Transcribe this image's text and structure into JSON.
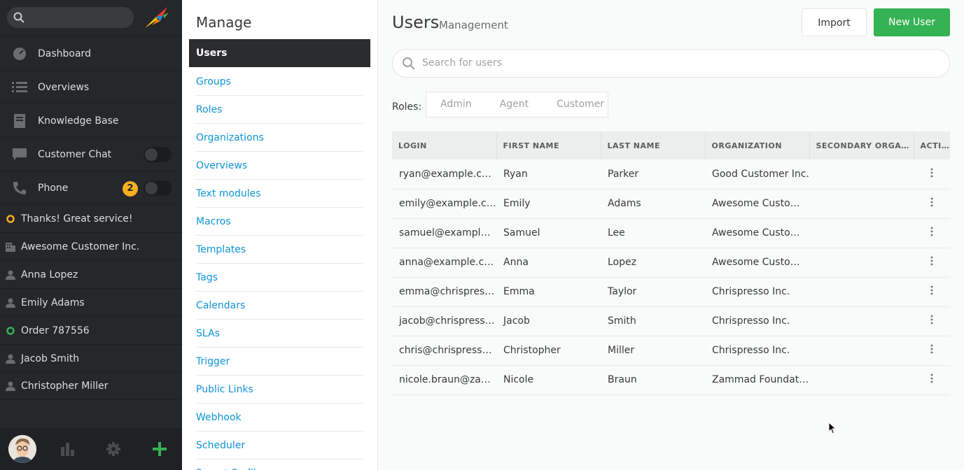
{
  "nav": {
    "search_placeholder": "",
    "items": [
      {
        "label": "Dashboard",
        "icon": "dashboard-icon"
      },
      {
        "label": "Overviews",
        "icon": "list-icon"
      },
      {
        "label": "Knowledge Base",
        "icon": "book-icon"
      },
      {
        "label": "Customer Chat",
        "icon": "chat-icon"
      },
      {
        "label": "Phone",
        "icon": "phone-icon",
        "badge": "2"
      }
    ],
    "tasks": [
      {
        "label": "Thanks! Great service!",
        "icon": "ticket-open-icon"
      },
      {
        "label": "Awesome Customer Inc.",
        "icon": "organization-icon"
      },
      {
        "label": "Anna Lopez",
        "icon": "user-icon"
      },
      {
        "label": "Emily Adams",
        "icon": "user-icon"
      },
      {
        "label": "Order 787556",
        "icon": "ticket-new-icon"
      },
      {
        "label": "Jacob Smith",
        "icon": "user-icon"
      },
      {
        "label": "Christopher Miller",
        "icon": "user-icon"
      }
    ]
  },
  "menu": {
    "title": "Manage",
    "items": [
      "Users",
      "Groups",
      "Roles",
      "Organizations",
      "Overviews",
      "Text modules",
      "Macros",
      "Templates",
      "Tags",
      "Calendars",
      "SLAs",
      "Trigger",
      "Public Links",
      "Webhook",
      "Scheduler",
      "Report Profiles"
    ]
  },
  "main": {
    "title": "Users",
    "subtitle": "Management",
    "import_label": "Import",
    "new_label": "New User",
    "search_placeholder": "Search for users",
    "roles_label": "Roles:",
    "roles": [
      "Admin",
      "Agent",
      "Customer"
    ],
    "columns": [
      "LOGIN",
      "FIRST NAME",
      "LAST NAME",
      "ORGANIZATION",
      "SECONDARY ORGANIZATIONS",
      "ACTIONS"
    ],
    "rows": [
      {
        "login": "ryan@example.com",
        "first": "Ryan",
        "last": "Parker",
        "org": "Good Customer Inc.",
        "secondary": ""
      },
      {
        "login": "emily@example.com",
        "first": "Emily",
        "last": "Adams",
        "org": "Awesome Customer Inc.",
        "secondary": ""
      },
      {
        "login": "samuel@example.com",
        "first": "Samuel",
        "last": "Lee",
        "org": "Awesome Customer Inc.",
        "secondary": ""
      },
      {
        "login": "anna@example.com",
        "first": "Anna",
        "last": "Lopez",
        "org": "Awesome Customer Inc.",
        "secondary": ""
      },
      {
        "login": "emma@chrispresso.com",
        "first": "Emma",
        "last": "Taylor",
        "org": "Chrispresso Inc.",
        "secondary": ""
      },
      {
        "login": "jacob@chrispresso.com",
        "first": "Jacob",
        "last": "Smith",
        "org": "Chrispresso Inc.",
        "secondary": ""
      },
      {
        "login": "chris@chrispresso.com",
        "first": "Christopher",
        "last": "Miller",
        "org": "Chrispresso Inc.",
        "secondary": ""
      },
      {
        "login": "nicole.braun@zammad.org",
        "first": "Nicole",
        "last": "Braun",
        "org": "Zammad Foundation",
        "secondary": ""
      }
    ]
  },
  "colors": {
    "accent": "#35b253",
    "link": "#0f94d6",
    "nav_bg": "#26272b",
    "badge": "#f5ae1f"
  }
}
